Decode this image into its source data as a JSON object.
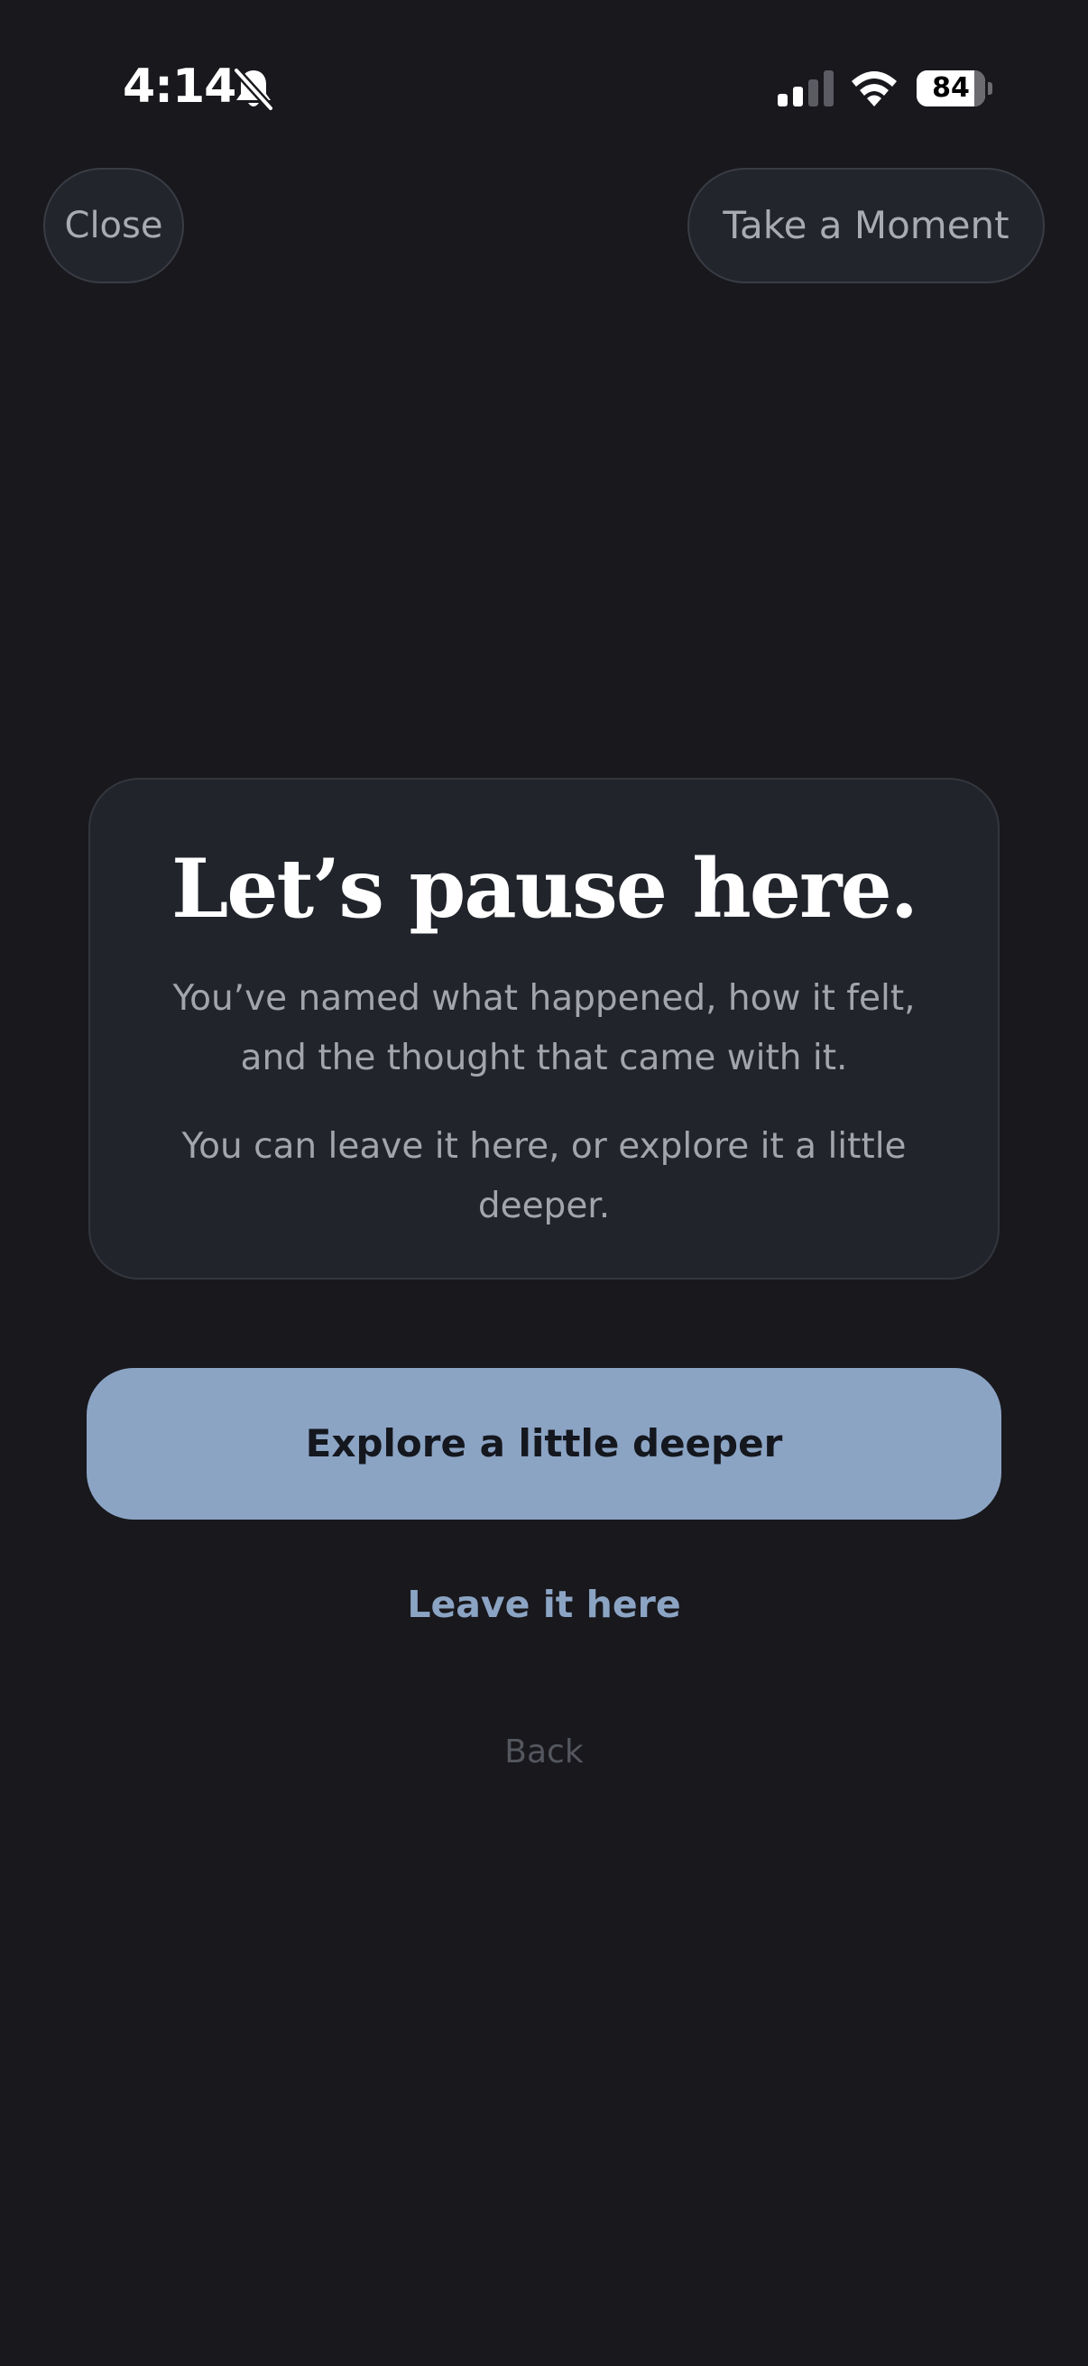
{
  "status_bar": {
    "time": "4:14",
    "battery_level": "84",
    "battery_fraction": 0.84,
    "signal_bars_active": 2,
    "signal_bars_total": 4,
    "icons": [
      "bell-slash-icon",
      "cellular-signal-icon",
      "wifi-icon",
      "battery-icon"
    ]
  },
  "header": {
    "close_label": "Close",
    "moment_label": "Take a Moment"
  },
  "card": {
    "title": "Let’s pause here.",
    "paragraph_1": "You’ve named what happened, how it felt, and the thought that came with it.",
    "paragraph_2": "You can leave it here, or explore it a little deeper."
  },
  "actions": {
    "primary_label": "Explore a little deeper",
    "secondary_label": "Leave it here",
    "back_label": "Back"
  },
  "colors": {
    "background": "#18181d",
    "card": "#22242c",
    "accent": "#8ca4c4",
    "muted_text": "#a3a5ad"
  }
}
